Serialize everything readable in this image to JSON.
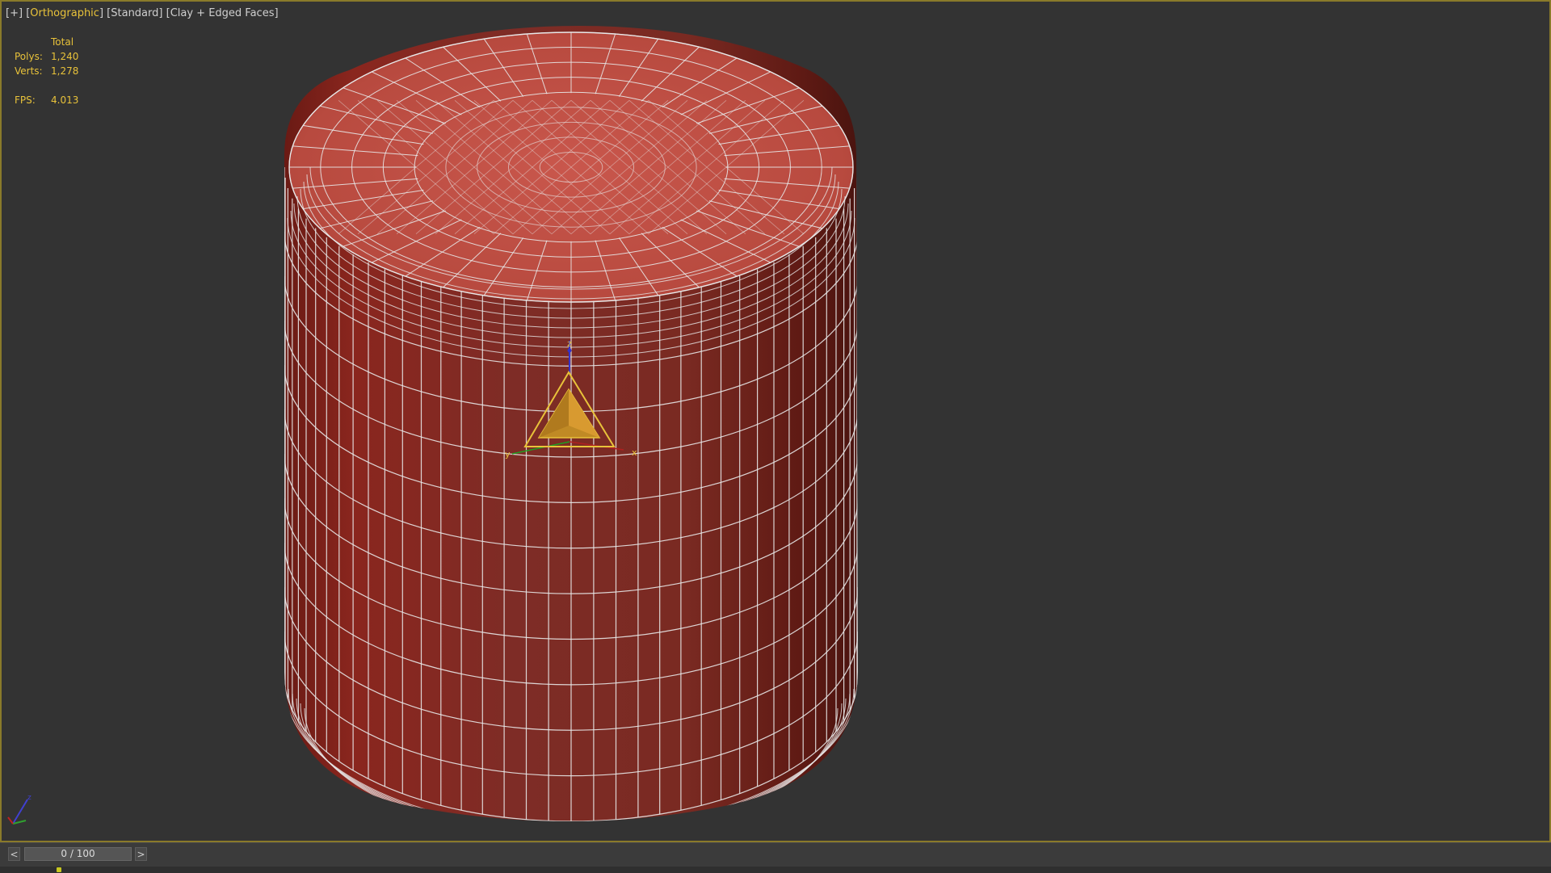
{
  "viewport": {
    "labels": {
      "menu": "[+]",
      "view": "Orthographic",
      "shading_mode": "Standard",
      "display_mode": "Clay + Edged Faces"
    },
    "stats": {
      "header": "Total",
      "polys_label": "Polys:",
      "polys_value": "1,240",
      "verts_label": "Verts:",
      "verts_value": "1,278",
      "fps_label": "FPS:",
      "fps_value": "4.013"
    },
    "gizmo_axes": {
      "x": "x",
      "y": "y",
      "z": "z"
    },
    "object": {
      "type": "cylinder",
      "color": "#8a2a22",
      "wire_color": "#e8e8e8"
    },
    "gizmo_color": "#e8c23a"
  },
  "timeline": {
    "prev_label": "<",
    "next_label": ">",
    "frame_display": "0 / 100"
  },
  "colors": {
    "viewport_bg": "#333333",
    "viewport_border": "#8a7a2a",
    "label_active": "#e8c23a"
  }
}
